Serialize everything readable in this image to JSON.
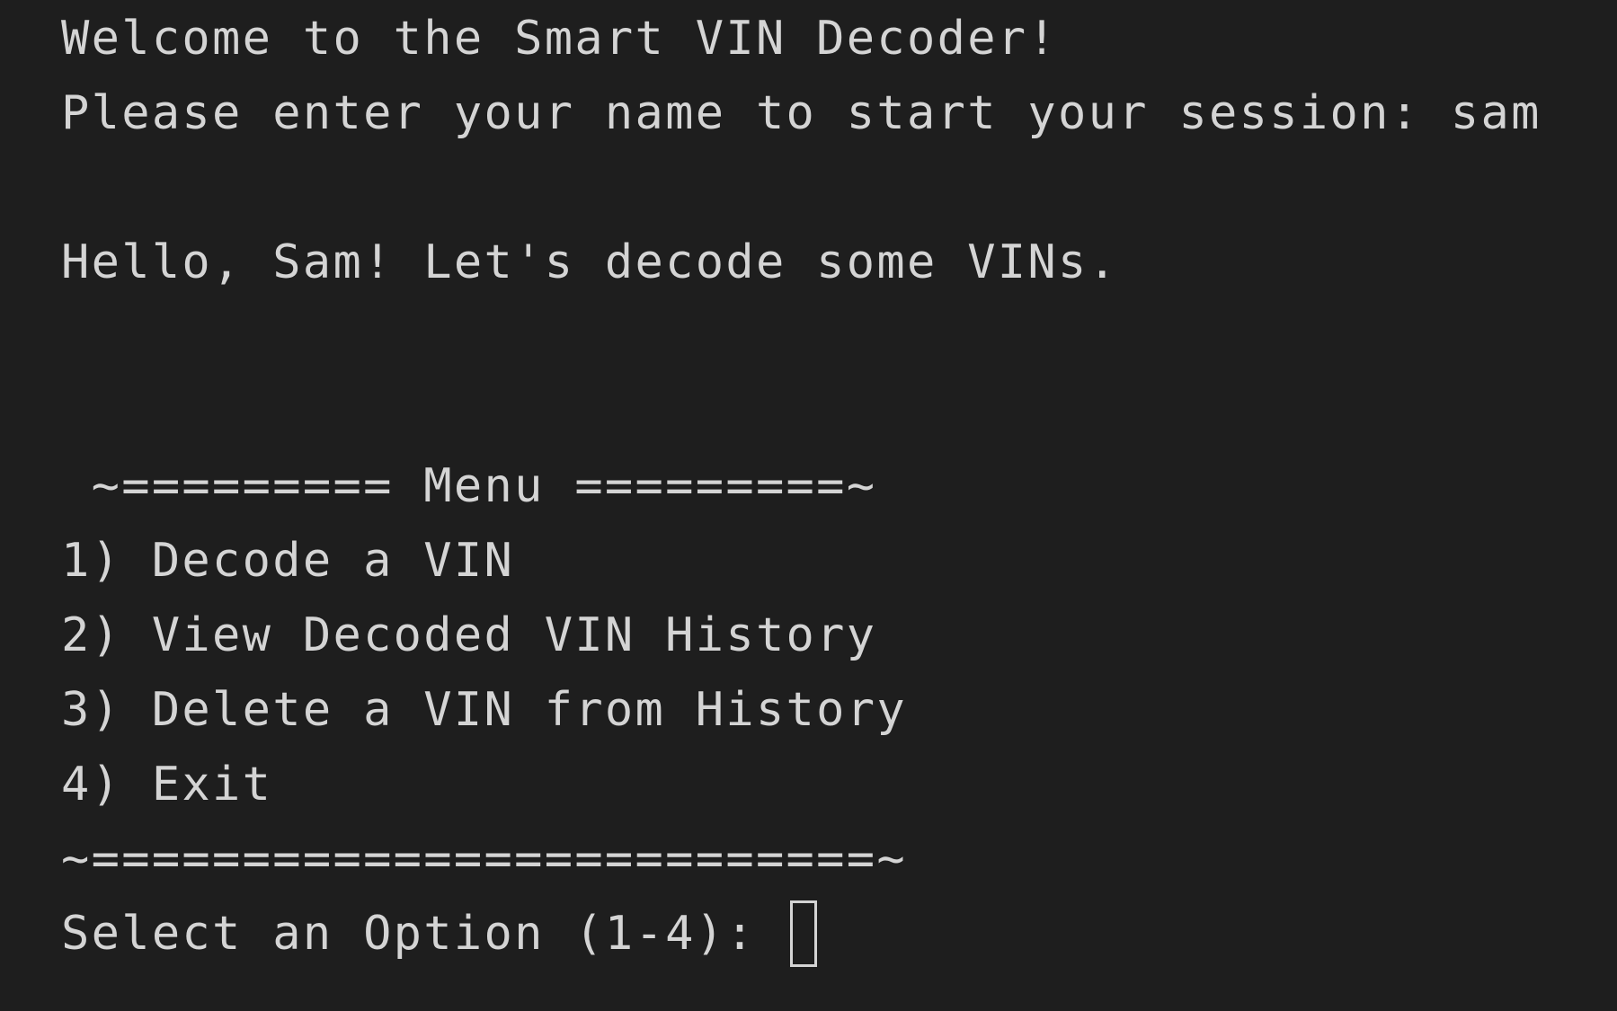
{
  "terminal": {
    "welcome": "Welcome to the Smart VIN Decoder!",
    "name_prompt": "Please enter your name to start your session: ",
    "name_input": "sam",
    "greeting": "Hello, Sam! Let's decode some VINs.",
    "menu_header": " ~========= Menu =========~",
    "menu_items": [
      "1) Decode a VIN",
      "2) View Decoded VIN History",
      "3) Delete a VIN from History",
      "4) Exit"
    ],
    "menu_footer": "~==========================~",
    "option_prompt": "Select an Option (1-4): ",
    "cursor_icon": "block-cursor-icon"
  },
  "colors": {
    "background": "#1e1e1e",
    "text": "#d4d4d4"
  }
}
